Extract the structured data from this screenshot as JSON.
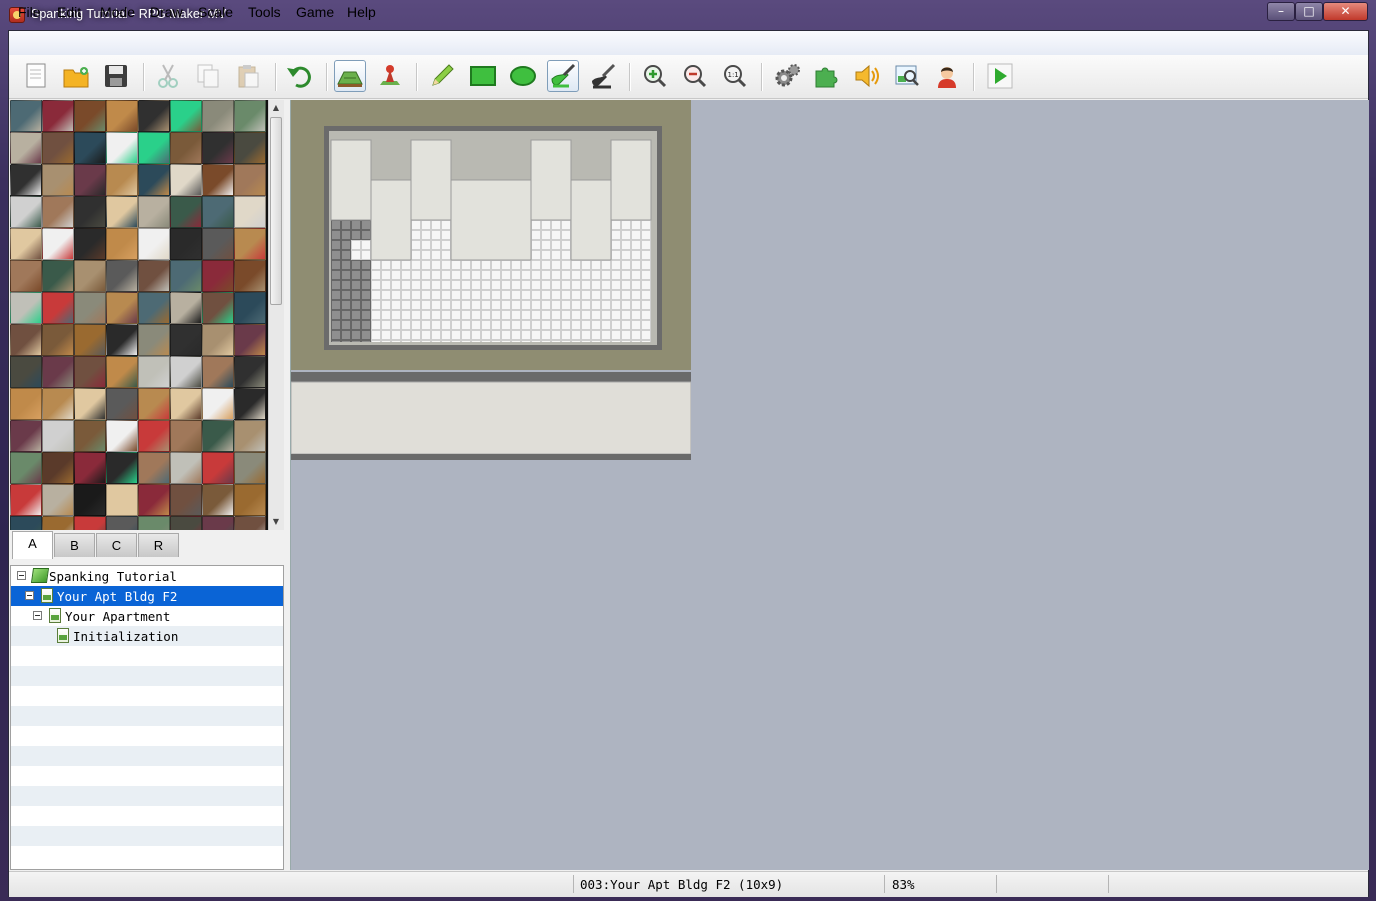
{
  "window": {
    "title": "Spanking Tutorial - RPG Maker MV",
    "controls": {
      "minimize": "–",
      "maximize": "□",
      "close": "✕"
    }
  },
  "menu": {
    "items": [
      "File",
      "Edit",
      "Mode",
      "Draw",
      "Scale",
      "Tools",
      "Game",
      "Help"
    ]
  },
  "toolbar": {
    "icons": [
      "new-project-icon",
      "open-project-icon",
      "save-project-icon",
      "cut-icon",
      "copy-icon",
      "paste-icon",
      "undo-icon",
      "map-mode-icon",
      "event-mode-icon",
      "pencil-icon",
      "rectangle-icon",
      "ellipse-icon",
      "flood-fill-icon",
      "shadow-pen-icon",
      "zoom-in-icon",
      "zoom-out-icon",
      "actual-size-icon",
      "database-icon",
      "plugin-manager-icon",
      "sound-test-icon",
      "event-searcher-icon",
      "character-generator-icon",
      "playtest-icon"
    ],
    "active": [
      "map-mode-icon",
      "flood-fill-icon"
    ]
  },
  "tileset": {
    "scroll_up": "▲",
    "scroll_down": "▼"
  },
  "tabs": [
    "A",
    "B",
    "C",
    "R"
  ],
  "active_tab": "A",
  "map_tree": {
    "project": "Spanking Tutorial",
    "maps": [
      {
        "name": "Your Apt Bldg F2",
        "selected": true,
        "level": 1
      },
      {
        "name": "Your Apartment",
        "selected": false,
        "level": 2
      },
      {
        "name": "Initialization",
        "selected": false,
        "level": 3
      }
    ]
  },
  "status": {
    "map_info": "003:Your Apt Bldg F2 (10x9)",
    "zoom": "83%"
  },
  "colors": {
    "selection": "#0a64d6",
    "editor_background": "#aeb4c1",
    "map_outside": "#8f8d72"
  }
}
